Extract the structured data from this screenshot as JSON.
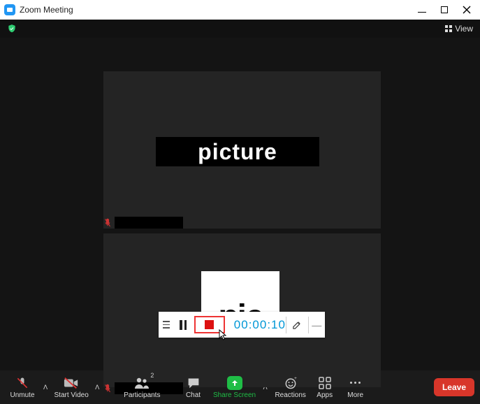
{
  "window": {
    "title": "Zoom Meeting"
  },
  "topbar": {
    "view_label": "View"
  },
  "panels": {
    "top_label": "picture",
    "bottom_label": "pic"
  },
  "recording": {
    "timer": "00:00:10"
  },
  "toolbar": {
    "unmute": "Unmute",
    "start_video": "Start Video",
    "participants": "Participants",
    "participants_count": "2",
    "chat": "Chat",
    "share_screen": "Share Screen",
    "reactions": "Reactions",
    "apps": "Apps",
    "more": "More",
    "leave": "Leave"
  }
}
